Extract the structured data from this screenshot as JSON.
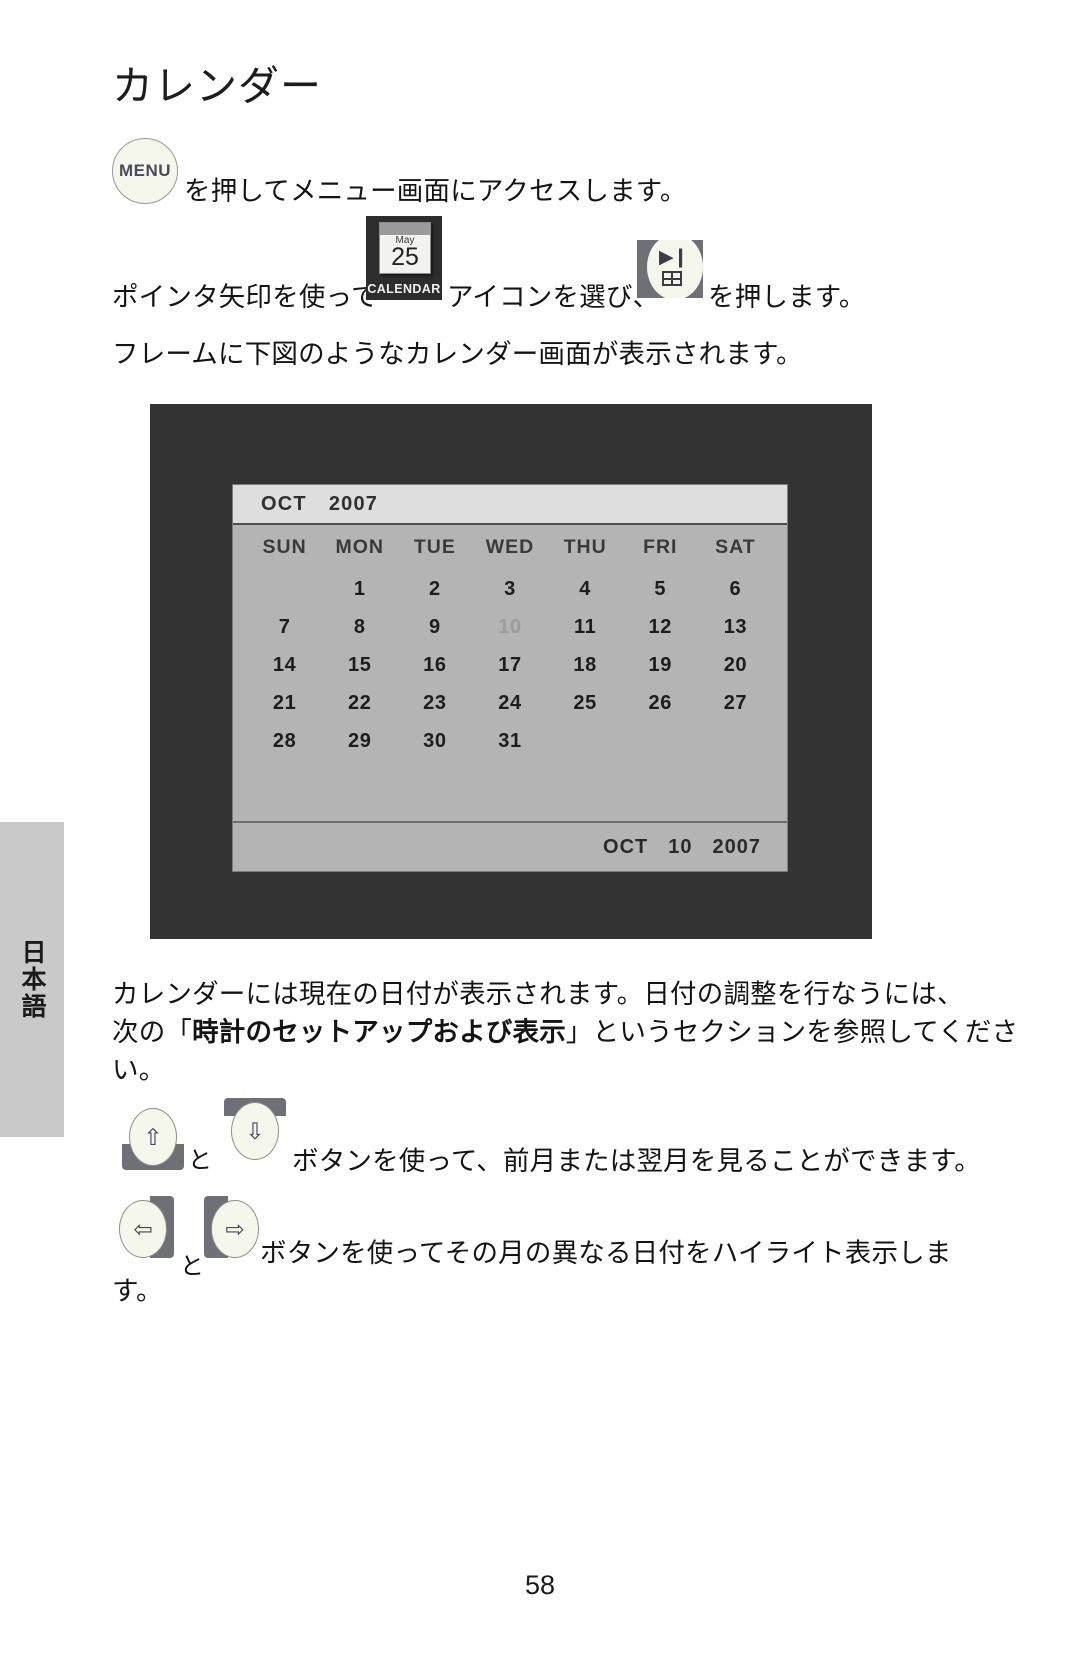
{
  "page": {
    "title": "カレンダー",
    "number": "58",
    "language_tab": "日本語"
  },
  "steps": {
    "menu": {
      "button_label": "MENU",
      "text": "を押してメニュー画面にアクセスします。"
    },
    "select": {
      "text_before": "ポインタ矢印を使って",
      "text_middle": "アイコンを選び、",
      "text_after": "を押します。",
      "calendar_icon": {
        "month": "May",
        "day": "25",
        "label": "CALENDAR"
      },
      "enter_icon": {
        "play_glyph": "▶❙",
        "grid_name": "grid-icon"
      }
    },
    "frame": {
      "text": "フレームに下図のようなカレンダー画面が表示されます。"
    }
  },
  "calendar_screen": {
    "header": {
      "month": "OCT",
      "year": "2007"
    },
    "weekdays": [
      "SUN",
      "MON",
      "TUE",
      "WED",
      "THU",
      "FRI",
      "SAT"
    ],
    "weeks": [
      [
        "",
        "1",
        "2",
        "3",
        "4",
        "5",
        "6"
      ],
      [
        "7",
        "8",
        "9",
        "10",
        "11",
        "12",
        "13"
      ],
      [
        "14",
        "15",
        "16",
        "17",
        "18",
        "19",
        "20"
      ],
      [
        "21",
        "22",
        "23",
        "24",
        "25",
        "26",
        "27"
      ],
      [
        "28",
        "29",
        "30",
        "31",
        "",
        "",
        ""
      ]
    ],
    "highlighted_day": "10",
    "footer": {
      "month": "OCT",
      "day": "10",
      "year": "2007"
    },
    "colors": {
      "bezel": "#333333",
      "screen_bg": "#b4b4b4",
      "header_bg": "#dedede",
      "highlight_text": "#9c9c9c"
    }
  },
  "paragraphs": {
    "current_date": {
      "line1": "カレンダーには現在の日付が表示されます。日付の調整を行なうには、",
      "line2_pre": "次の「",
      "line2_bold": "時計のセットアップおよび表示",
      "line2_post": "」というセクションを参照してくださ",
      "line3": "い。"
    }
  },
  "nav_updown": {
    "up_glyph": "⇧",
    "down_glyph": "⇩",
    "conjunction": "と",
    "text": "ボタンを使って、前月または翌月を見ることができます。"
  },
  "nav_leftright": {
    "left_glyph": "⇦",
    "right_glyph": "⇨",
    "conjunction": "と",
    "text_line1": "ボタンを使ってその月の異なる日付をハイライト表示しま",
    "text_line2": "す。"
  }
}
